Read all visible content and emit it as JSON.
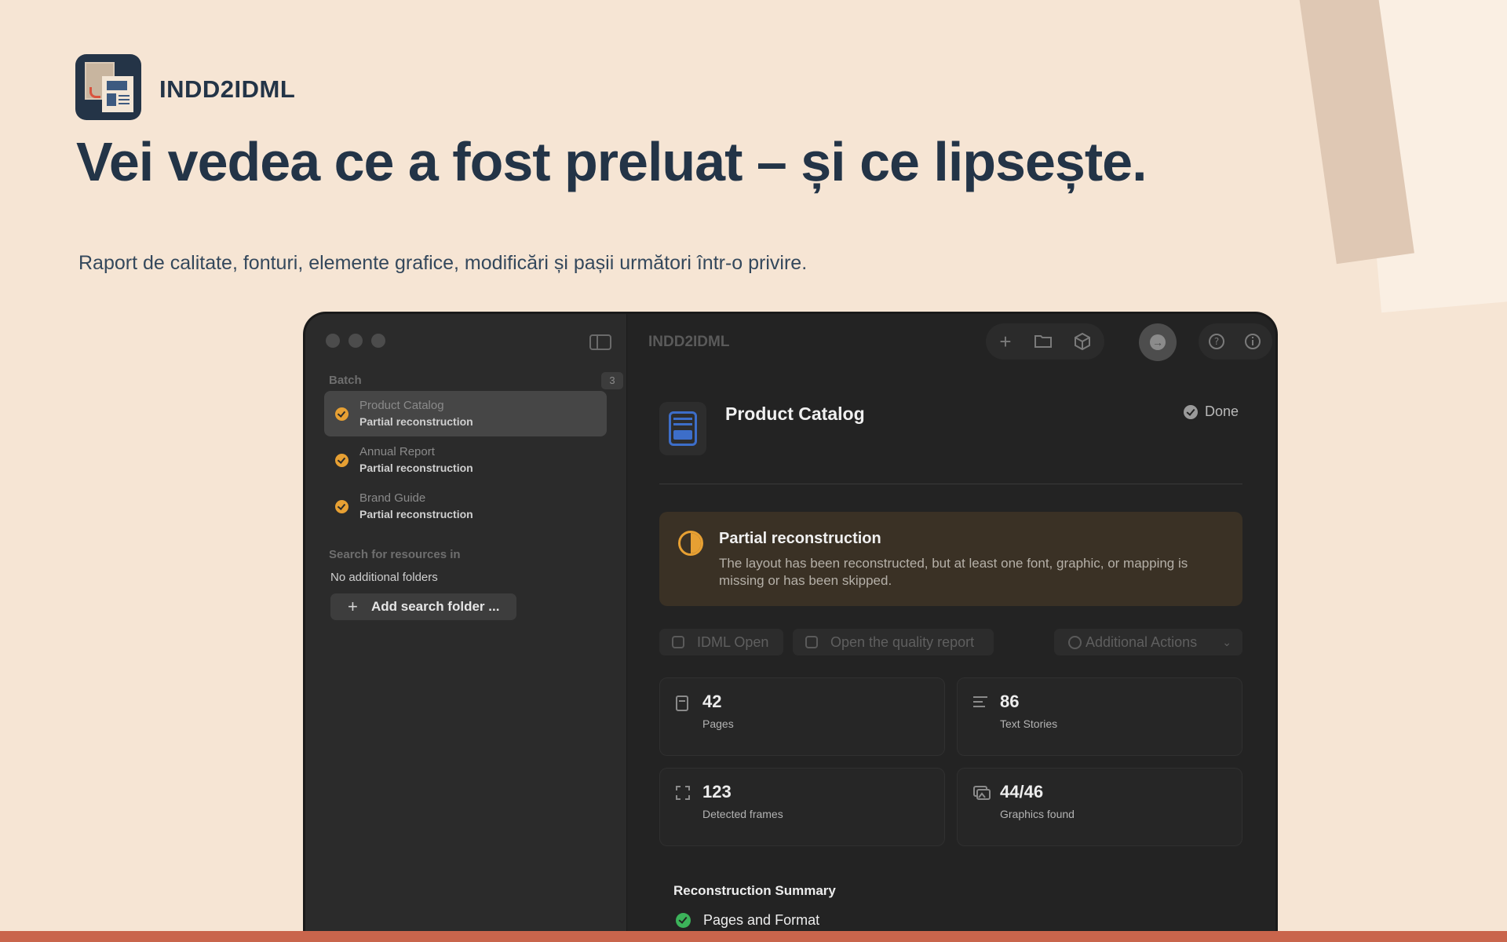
{
  "brand": {
    "name": "INDD2IDML"
  },
  "hero": {
    "headline": "Vei vedea ce a fost preluat – și ce lipsește.",
    "subline": "Raport de calitate, fonturi, elemente grafice, modificări și pașii următori într-o privire."
  },
  "window": {
    "title": "INDD2IDML",
    "sidebar": {
      "batch_label": "Batch",
      "batch_count": "3",
      "items": [
        {
          "title": "Product Catalog",
          "status": "Partial reconstruction"
        },
        {
          "title": "Annual Report",
          "status": "Partial reconstruction"
        },
        {
          "title": "Brand Guide",
          "status": "Partial reconstruction"
        }
      ],
      "search_label": "Search for resources in",
      "no_folders": "No additional folders",
      "add_folder_label": "Add search folder ..."
    },
    "main": {
      "doc_title": "Product Catalog",
      "status": "Done",
      "warning": {
        "title": "Partial reconstruction",
        "body": "The layout has been reconstructed, but at least one font, graphic, or mapping is missing or has been skipped."
      },
      "actions": {
        "idml_open": "IDML Open",
        "quality_report": "Open the quality report",
        "more": "Additional Actions"
      },
      "stats": [
        {
          "value": "42",
          "label": "Pages"
        },
        {
          "value": "86",
          "label": "Text Stories"
        },
        {
          "value": "123",
          "label": "Detected frames"
        },
        {
          "value": "44/46",
          "label": "Graphics found"
        }
      ],
      "summary": {
        "title": "Reconstruction Summary",
        "items": [
          {
            "label": "Pages and Format"
          }
        ]
      }
    }
  },
  "colors": {
    "background": "#f6e5d4",
    "navy": "#233447",
    "accent_orange": "#e7a033",
    "accent_red": "#c9654c",
    "success_green": "#3cb35a"
  }
}
